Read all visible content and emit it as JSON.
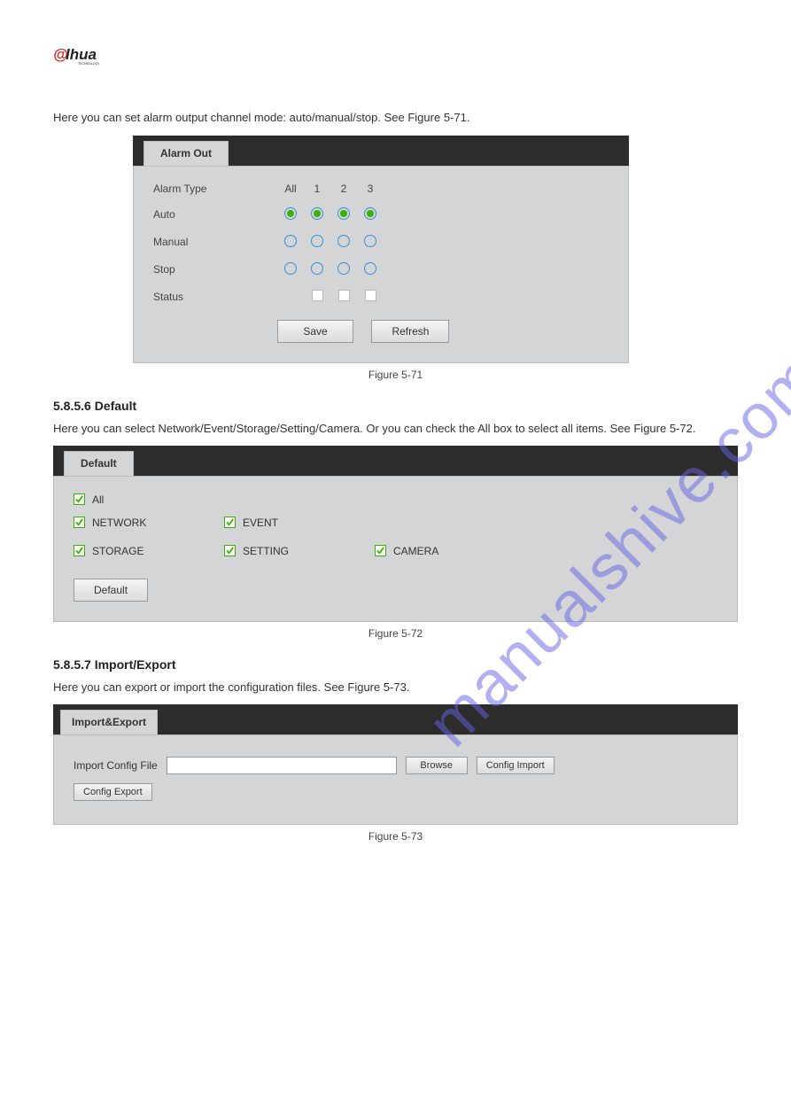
{
  "logo": {
    "brand": "alhua",
    "sub": "TECHNOLOGY"
  },
  "watermark": "manualshive.com",
  "intro_text": "Here you can set alarm output channel mode: auto/manual/stop. See Figure 5-71.",
  "alarm": {
    "tab_label": "Alarm Out",
    "row_labels": {
      "type": "Alarm Type",
      "auto": "Auto",
      "manual": "Manual",
      "stop": "Stop",
      "status": "Status"
    },
    "columns": [
      "All",
      "1",
      "2",
      "3"
    ],
    "buttons": {
      "save": "Save",
      "refresh": "Refresh"
    }
  },
  "alarm_caption": "Figure 5-71",
  "default_section": {
    "heading": "5.8.5.6 Default",
    "text": "Here you can select Network/Event/Storage/Setting/Camera. Or you can check the All box to select all items. See Figure 5-72."
  },
  "default_panel": {
    "tab_label": "Default",
    "items": {
      "all": "All",
      "network": "NETWORK",
      "event": "EVENT",
      "storage": "STORAGE",
      "setting": "SETTING",
      "camera": "CAMERA"
    },
    "button": "Default"
  },
  "default_caption": "Figure 5-72",
  "imp_section": {
    "heading": "5.8.5.7 Import/Export",
    "text": "Here you can export or import the configuration files. See Figure 5-73."
  },
  "imp_panel": {
    "tab_label": "Import&Export",
    "label_import_file": "Import Config File",
    "buttons": {
      "browse": "Browse",
      "config_import": "Config Import",
      "config_export": "Config Export"
    }
  },
  "imp_caption": "Figure 5-73"
}
